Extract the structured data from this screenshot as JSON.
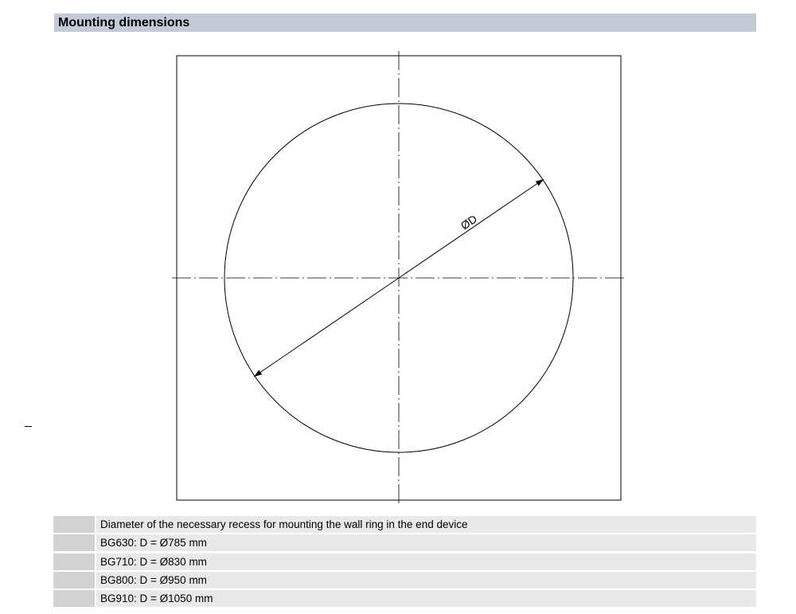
{
  "header": {
    "title": "Mounting dimensions"
  },
  "drawing": {
    "dimension_label": "ØD"
  },
  "legend": {
    "rows": [
      {
        "text": "Diameter of the necessary recess for mounting the wall ring in the end device"
      },
      {
        "text": "BG630: D = Ø785 mm"
      },
      {
        "text": "BG710: D = Ø830 mm"
      },
      {
        "text": "BG800: D = Ø950 mm"
      },
      {
        "text": "BG910: D = Ø1050 mm"
      }
    ]
  }
}
